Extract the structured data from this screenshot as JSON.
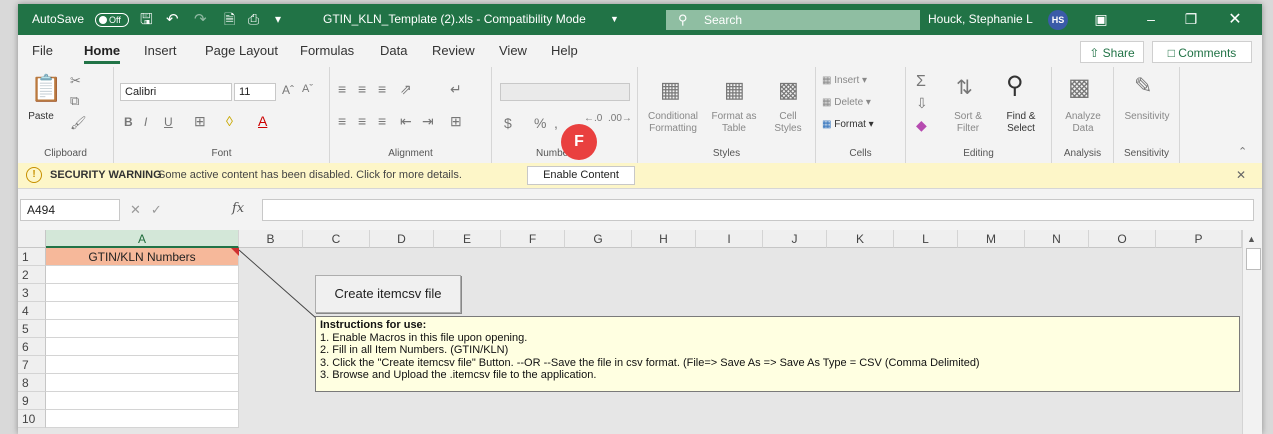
{
  "titlebar": {
    "autosave_label": "AutoSave",
    "autosave_state": "Off",
    "filename": "GTIN_KLN_Template (2).xls - Compatibility Mode",
    "search_placeholder": "Search",
    "user_name": "Houck, Stephanie L",
    "user_initials": "HS"
  },
  "menu": {
    "file": "File",
    "home": "Home",
    "insert": "Insert",
    "page_layout": "Page Layout",
    "formulas": "Formulas",
    "data": "Data",
    "review": "Review",
    "view": "View",
    "help": "Help",
    "share": "Share",
    "comments": "Comments"
  },
  "ribbon": {
    "clipboard": {
      "label": "Clipboard",
      "paste": "Paste"
    },
    "font": {
      "label": "Font",
      "name": "Calibri",
      "size": "11",
      "bold": "B",
      "italic": "I",
      "underline": "U"
    },
    "alignment": {
      "label": "Alignment"
    },
    "number": {
      "label": "Number"
    },
    "styles": {
      "label": "Styles",
      "conditional": "Conditional Formatting",
      "format_as_table": "Format as Table",
      "cell_styles": "Cell Styles"
    },
    "cells": {
      "label": "Cells",
      "insert": "Insert",
      "delete": "Delete",
      "format": "Format"
    },
    "editing": {
      "label": "Editing",
      "sort_filter": "Sort & Filter",
      "find_select": "Find & Select"
    },
    "analysis": {
      "label": "Analysis",
      "analyze_data": "Analyze Data"
    },
    "sensitivity": {
      "label": "Sensitivity",
      "button": "Sensitivity"
    }
  },
  "step_badge": "F",
  "security_bar": {
    "title": "SECURITY WARNING",
    "message": "Some active content has been disabled. Click for more details.",
    "enable_button": "Enable Content"
  },
  "formula_bar": {
    "name_box": "A494",
    "fx": "fx",
    "formula": ""
  },
  "sheet": {
    "columns": [
      "A",
      "B",
      "C",
      "D",
      "E",
      "F",
      "G",
      "H",
      "I",
      "J",
      "K",
      "L",
      "M",
      "N",
      "O",
      "P"
    ],
    "rows": [
      "1",
      "2",
      "3",
      "4",
      "5",
      "6",
      "7",
      "8",
      "9",
      "10"
    ],
    "a1": "GTIN/KLN Numbers",
    "create_button": "Create itemcsv file",
    "note": {
      "title": "Instructions for use:",
      "lines": [
        "1. Enable Macros in this file upon opening.",
        "2. Fill in all Item Numbers. (GTIN/KLN)",
        "3. Click the \"Create itemcsv file\" Button. --OR --Save the file in csv format. (File=> Save As => Save As Type = CSV (Comma Delimited)",
        "3. Browse and Upload the .itemcsv file to the application."
      ]
    }
  },
  "colors": {
    "excel_green": "#217346",
    "header_cell": "#f6b89a",
    "note_bg": "#ffffe1",
    "security_bar": "#fdf6c8",
    "badge": "#e9403f"
  }
}
